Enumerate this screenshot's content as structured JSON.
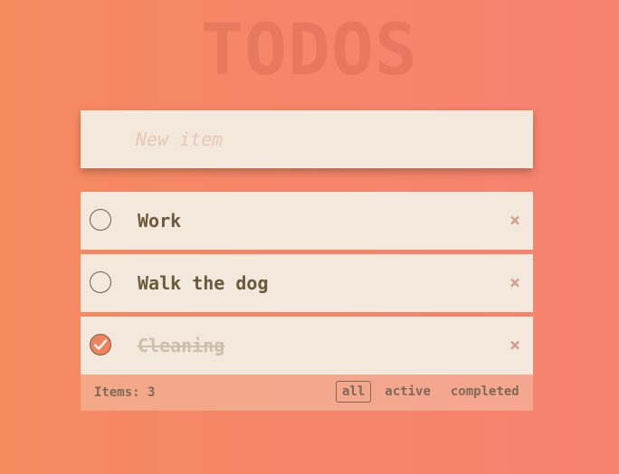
{
  "header": {
    "title": "TODOS"
  },
  "new_item": {
    "placeholder": "New item",
    "value": ""
  },
  "todos": [
    {
      "label": "Work",
      "completed": false,
      "remove_icon": "×"
    },
    {
      "label": "Walk the dog",
      "completed": false,
      "remove_icon": "×"
    },
    {
      "label": "Cleaning",
      "completed": true,
      "remove_icon": "×"
    }
  ],
  "footer": {
    "count_text": "Items: 3",
    "filters": [
      {
        "label": "all",
        "selected": true
      },
      {
        "label": "active",
        "selected": false
      },
      {
        "label": "completed",
        "selected": false
      }
    ]
  },
  "colors": {
    "background_start": "#f58a5f",
    "background_end": "#f68270",
    "card": "#f2e8dc",
    "text": "#6c5a3c",
    "completed_text": "#cdbfaa",
    "check_done": "#f0825c",
    "remove": "#d49a94"
  },
  "icons": {
    "checkbox": "circle-icon",
    "checkbox_done": "checkmark-icon",
    "remove": "close-icon"
  }
}
